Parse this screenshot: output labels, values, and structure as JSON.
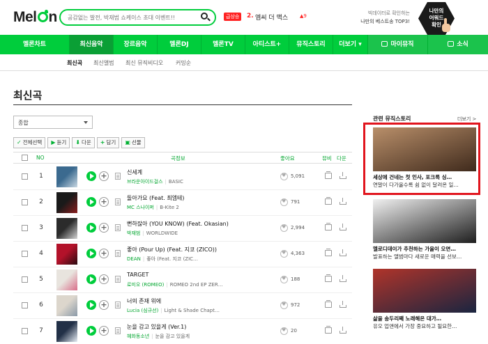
{
  "header": {
    "logo_text_1": "Mel",
    "logo_text_2": "n",
    "search_placeholder": "공감없는 발전, 박재범 쇼케이스 초대 이벤트!!",
    "rank_badge": "급상승",
    "rank_number": "2.",
    "rank_title": "엠씨 더 맥스",
    "rank_change": "▲9",
    "promo_line1": "빅데이터로 확인하는",
    "promo_line2": "나만의 베스트송 TOP3!",
    "promo_hex_line1": "나만의",
    "promo_hex_line2": "어워드",
    "promo_hex_line3": "확인"
  },
  "nav": {
    "items": [
      "멜론차트",
      "최신음악",
      "장르음악",
      "멜론DJ",
      "멜론TV",
      "아티스트+",
      "뮤직스토리",
      "더보기 ▾"
    ],
    "active_index": 1,
    "mymusic": "마이뮤직",
    "social": "소식"
  },
  "subnav": {
    "items": [
      "최신곡",
      "최신앨범",
      "최신 뮤직비디오",
      "커밍순"
    ],
    "active_index": 0
  },
  "page_title": "최신곡",
  "filter": {
    "selected": "종합"
  },
  "toolbar": {
    "select_all": "전체선택",
    "listen": "듣기",
    "download": "다운",
    "add": "담기",
    "gift": "선물"
  },
  "table": {
    "headers": {
      "no": "NO",
      "song": "곡정보",
      "like": "좋아요",
      "mv": "뮤비",
      "dl": "다운"
    },
    "rows": [
      {
        "no": "1",
        "title": "신세계",
        "artist": "브라운아이드걸스",
        "album": "BASIC",
        "likes": "5,091",
        "art": [
          "#3b6a8f",
          "#c9d8e3"
        ]
      },
      {
        "no": "2",
        "title": "돌아가요 (Feat. 최엠테)",
        "artist": "MC 스나이퍼",
        "album": "B-Kite 2",
        "likes": "791",
        "art": [
          "#1a1a1a",
          "#8a1d1d"
        ]
      },
      {
        "no": "3",
        "title": "뻔하잖아 (YOU KNOW) (Feat. Okasian)",
        "artist": "박재범",
        "album": "WORLDWIDE",
        "likes": "2,994",
        "art": [
          "#2b2b2b",
          "#d4d4d4"
        ]
      },
      {
        "no": "4",
        "title": "좋아 (Pour Up) (Feat. 지코 (ZICO))",
        "artist": "DEAN",
        "album": "좋아 (Feat. 지코 (ZIC…",
        "likes": "4,363",
        "art": [
          "#b3122a",
          "#2a0b10"
        ]
      },
      {
        "no": "5",
        "title": "TARGET",
        "artist": "로미오 (ROMEO)",
        "album": "ROMEO 2nd EP ZER…",
        "likes": "188",
        "art": [
          "#e8e4de",
          "#d96e8a"
        ]
      },
      {
        "no": "6",
        "title": "너의 존재 위에",
        "artist": "Lucia (심규선)",
        "album": "Light & Shade Chapt…",
        "likes": "972",
        "art": [
          "#dcd6cc",
          "#8b9aa8"
        ]
      },
      {
        "no": "7",
        "title": "눈을 감고 있을게 (Ver.1)",
        "artist": "혜화동소년",
        "album": "눈을 감고 있을게",
        "likes": "20",
        "art": [
          "#223047",
          "#e8eef5"
        ]
      }
    ]
  },
  "side": {
    "title": "관련 뮤직스토리",
    "more": "더보기 >",
    "cards": [
      {
        "line1": "세상에 건네는 첫 인사, 포크록 싱…",
        "line2": "연말이 다가올수록 쉼 없이 달려온 일…",
        "art": [
          "#b98f6a",
          "#3f2a1c"
        ]
      },
      {
        "line1": "멜로디데이가 추천하는 가을이 오면…",
        "line2": "발표하는 앨범마다 새로운 매력을 선보…",
        "art": [
          "#f0f0f0",
          "#1e1e1e"
        ]
      },
      {
        "line1": "삶을 송두리째 노래해온 대가…",
        "line2": "유오 업앤에서 가장 중요하고 될요한…",
        "art": [
          "#b0342a",
          "#1a2540"
        ]
      }
    ]
  }
}
